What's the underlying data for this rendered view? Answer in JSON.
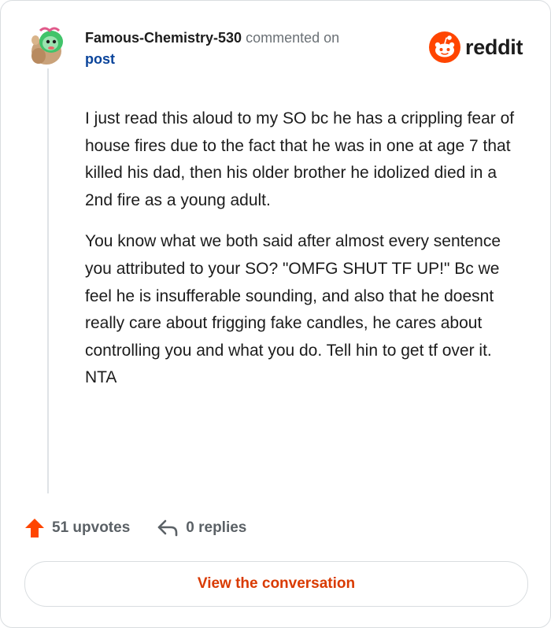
{
  "comment": {
    "username": "Famous-Chemistry-530",
    "action_text": "commented on",
    "post_link_text": "post",
    "paragraphs": [
      "I just read this aloud to my SO bc he has a crippling fear of house fires due to the fact that he was in one at age 7 that killed his dad, then his older brother he idolized died in a 2nd fire as a young adult.",
      "You know what we both said after almost every sentence you attributed to your SO? \"OMFG SHUT TF UP!\" Bc we feel he is insufferable sounding, and also that he doesnt really care about frigging fake candles, he cares about controlling you and what you do. Tell hin to get tf over it. NTA"
    ]
  },
  "brand": {
    "name": "reddit",
    "icon": "reddit-logo-icon",
    "color": "#ff4500"
  },
  "actions": {
    "upvotes_label": "51 upvotes",
    "replies_label": "0 replies",
    "upvote_icon": "upvote-arrow-icon",
    "reply_icon": "reply-arrow-icon",
    "upvote_color": "#ff4500"
  },
  "cta": {
    "label": "View the conversation",
    "color": "#d93a00"
  }
}
